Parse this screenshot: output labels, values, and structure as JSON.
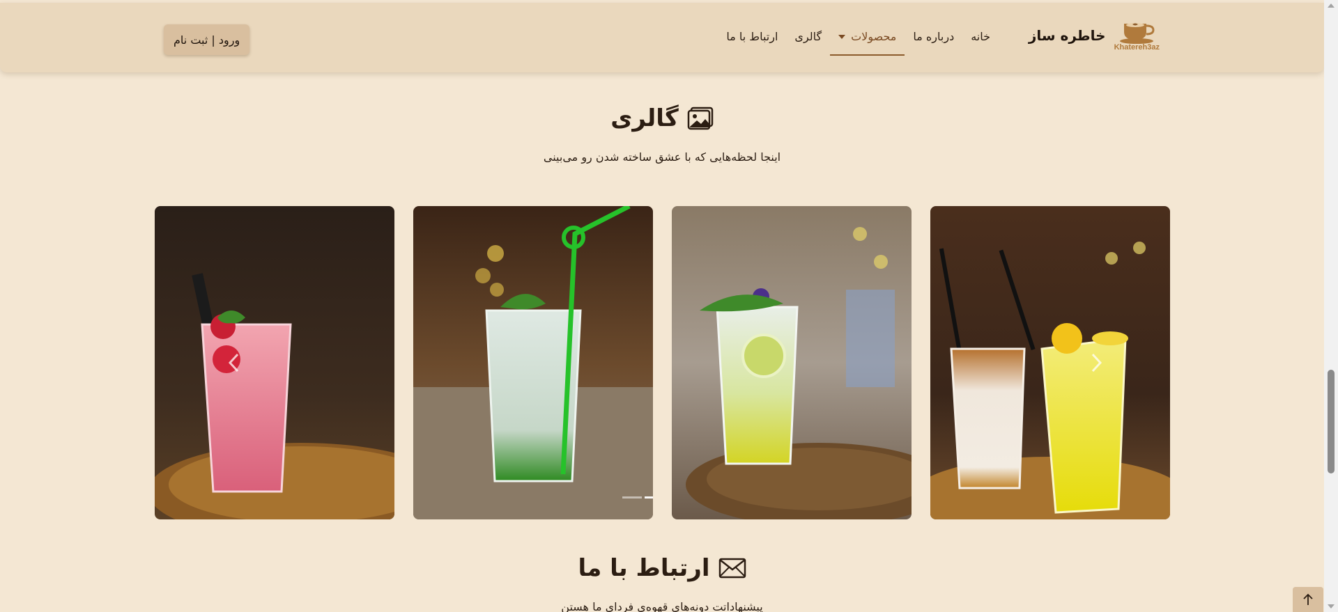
{
  "brand": {
    "name": "خاطره ساز",
    "logo_text": "Khatereh3az"
  },
  "nav": {
    "items": [
      {
        "label": "خانه"
      },
      {
        "label": "درباره ما"
      },
      {
        "label": "محصولات"
      },
      {
        "label": "گالری"
      },
      {
        "label": "ارتباط با ما"
      }
    ]
  },
  "auth": {
    "label": "ورود | ثبت نام"
  },
  "gallery": {
    "title": "گالری",
    "subtitle": "اینجا لحظه‌هایی که با عشق ساخته شدن رو می‌بینی",
    "icon": "image-icon"
  },
  "contact": {
    "title": "ارتباط با ما",
    "subtitle": "پیشنهاداتت دونه‌های قهوه‌ی فردای ما هستن",
    "icon": "envelope-icon"
  },
  "colors": {
    "background": "#f4e7d3",
    "navbar": "#ead8bd",
    "accent": "#8b5a2b",
    "button": "#d9bf9f"
  }
}
